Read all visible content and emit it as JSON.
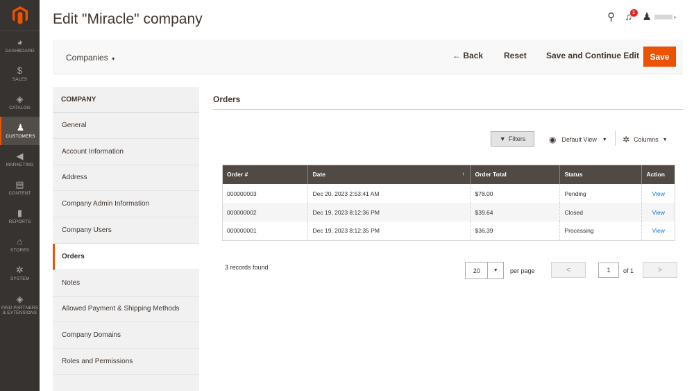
{
  "sidebar": {
    "items": [
      {
        "label": "DASHBOARD",
        "icon": "dashboard-icon",
        "glyph": "◕"
      },
      {
        "label": "SALES",
        "icon": "dollar-icon",
        "glyph": "$"
      },
      {
        "label": "CATALOG",
        "icon": "box-icon",
        "glyph": "◈"
      },
      {
        "label": "CUSTOMERS",
        "icon": "person-icon",
        "glyph": "♟"
      },
      {
        "label": "MARKETING",
        "icon": "megaphone-icon",
        "glyph": "◀"
      },
      {
        "label": "CONTENT",
        "icon": "layout-icon",
        "glyph": "▤"
      },
      {
        "label": "REPORTS",
        "icon": "bar-chart-icon",
        "glyph": "▮"
      },
      {
        "label": "STORES",
        "icon": "store-icon",
        "glyph": "⌂"
      },
      {
        "label": "SYSTEM",
        "icon": "gear-icon",
        "glyph": "✲"
      },
      {
        "label": "FIND PARTNERS & EXTENSIONS",
        "icon": "puzzle-box-icon",
        "glyph": "◈"
      }
    ]
  },
  "header": {
    "title": "Edit \"Miracle\" company",
    "notification_count": "1",
    "search_glyph": "⚲",
    "bell_glyph": "♫",
    "user_glyph": "♟"
  },
  "actions": {
    "store_switcher": "Companies",
    "back": "← Back",
    "reset": "Reset",
    "save_continue": "Save and Continue Edit",
    "save": "Save"
  },
  "tabs": {
    "header": "COMPANY",
    "items": [
      "General",
      "Account Information",
      "Address",
      "Company Admin Information",
      "Company Users",
      "Orders",
      "Notes",
      "Allowed Payment & Shipping Methods",
      "Company Domains",
      "Roles and Permissions"
    ],
    "active_index": 5
  },
  "orders": {
    "section_title": "Orders",
    "toolbar": {
      "filters": "Filters",
      "default_view": "Default View",
      "columns": "Columns"
    },
    "columns": [
      "Order #",
      "Date",
      "Order Total",
      "Status",
      "Action"
    ],
    "rows": [
      {
        "order": "000000003",
        "date": "Dec 20, 2023 2:53:41 AM",
        "total": "$78.00",
        "status": "Pending",
        "action": "View"
      },
      {
        "order": "000000002",
        "date": "Dec 19, 2023 8:12:36 PM",
        "total": "$39.64",
        "status": "Closed",
        "action": "View"
      },
      {
        "order": "000000001",
        "date": "Dec 19, 2023 8:12:35 PM",
        "total": "$36.39",
        "status": "Processing",
        "action": "View"
      }
    ],
    "records_found": "3 records found",
    "per_page_value": "20",
    "per_page_label": "per page",
    "page_current": "1",
    "page_of": "of 1"
  },
  "colors": {
    "accent": "#eb5202",
    "sidebar_bg": "#373330",
    "grid_header_bg": "#514943",
    "link": "#007bdb"
  }
}
